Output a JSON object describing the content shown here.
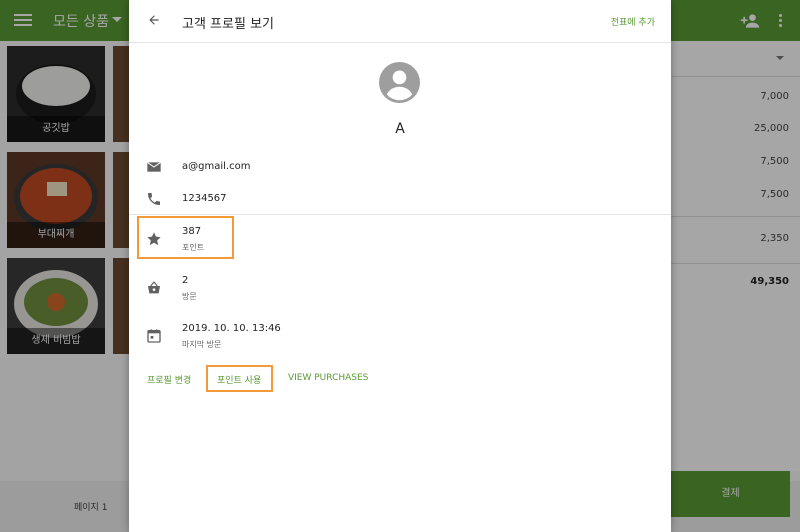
{
  "background": {
    "app_title": "모든 상품",
    "tiles": [
      {
        "label": "공깃밥"
      },
      {
        "label": "부대찌개"
      },
      {
        "label": "생제 비빔밥"
      }
    ],
    "cart_amounts": [
      "7,000",
      "25,000",
      "7,500",
      "7,500",
      "2,350"
    ],
    "cart_total": "49,350",
    "page_label": "페이지 1",
    "pay_label": "결제",
    "colors": {
      "brand": "#5a9a33"
    }
  },
  "dialog": {
    "title": "고객 프로필 보기",
    "add_to_slip": "전표에 추가",
    "customer_name": "A",
    "email": "a@gmail.com",
    "phone": "1234567",
    "points_value": "387",
    "points_label": "포인트",
    "visits_value": "2",
    "visits_label": "방문",
    "last_visit_value": "2019. 10. 10. 13:46",
    "last_visit_label": "마지막 방문",
    "actions": {
      "edit_profile": "프로필 변경",
      "use_points": "포인트 사용",
      "view_purchases": "VIEW PURCHASES"
    },
    "highlight_color": "#f29a38"
  }
}
